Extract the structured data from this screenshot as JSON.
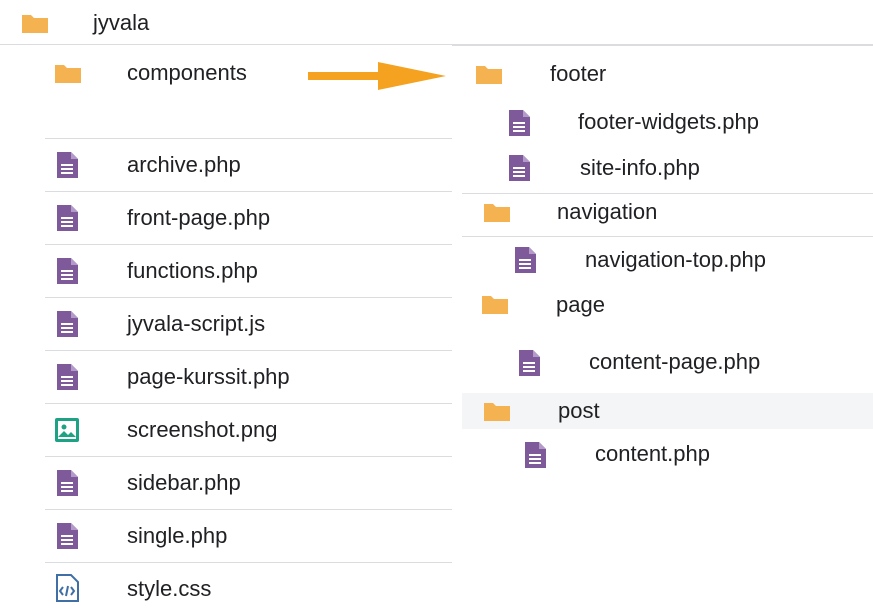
{
  "root": {
    "name": "jyvala",
    "icon": "folder-icon"
  },
  "left_items": [
    {
      "name": "components",
      "icon": "folder-icon"
    },
    {
      "name": "archive.php",
      "icon": "document-icon"
    },
    {
      "name": "front-page.php",
      "icon": "document-icon"
    },
    {
      "name": "functions.php",
      "icon": "document-icon"
    },
    {
      "name": "jyvala-script.js",
      "icon": "document-icon"
    },
    {
      "name": "page-kurssit.php",
      "icon": "document-icon"
    },
    {
      "name": "screenshot.png",
      "icon": "image-icon"
    },
    {
      "name": "sidebar.php",
      "icon": "document-icon"
    },
    {
      "name": "single.php",
      "icon": "document-icon"
    },
    {
      "name": "style.css",
      "icon": "code-icon"
    }
  ],
  "arrow": {
    "icon": "arrow-right-icon",
    "color": "#f4a21f"
  },
  "right_items": [
    {
      "name": "footer",
      "icon": "folder-icon"
    },
    {
      "name": "footer-widgets.php",
      "icon": "document-icon"
    },
    {
      "name": "site-info.php",
      "icon": "document-icon"
    },
    {
      "name": "navigation",
      "icon": "folder-icon"
    },
    {
      "name": "navigation-top.php",
      "icon": "document-icon"
    },
    {
      "name": "page",
      "icon": "folder-icon"
    },
    {
      "name": "content-page.php",
      "icon": "document-icon"
    },
    {
      "name": "post",
      "icon": "folder-icon"
    },
    {
      "name": "content.php",
      "icon": "document-icon"
    }
  ],
  "colors": {
    "folder": "#f4b350",
    "document": "#7e5a9b",
    "image": "#1da384",
    "code": "#3f6fa5",
    "divider": "#dadce0",
    "arrow": "#f4a21f"
  }
}
